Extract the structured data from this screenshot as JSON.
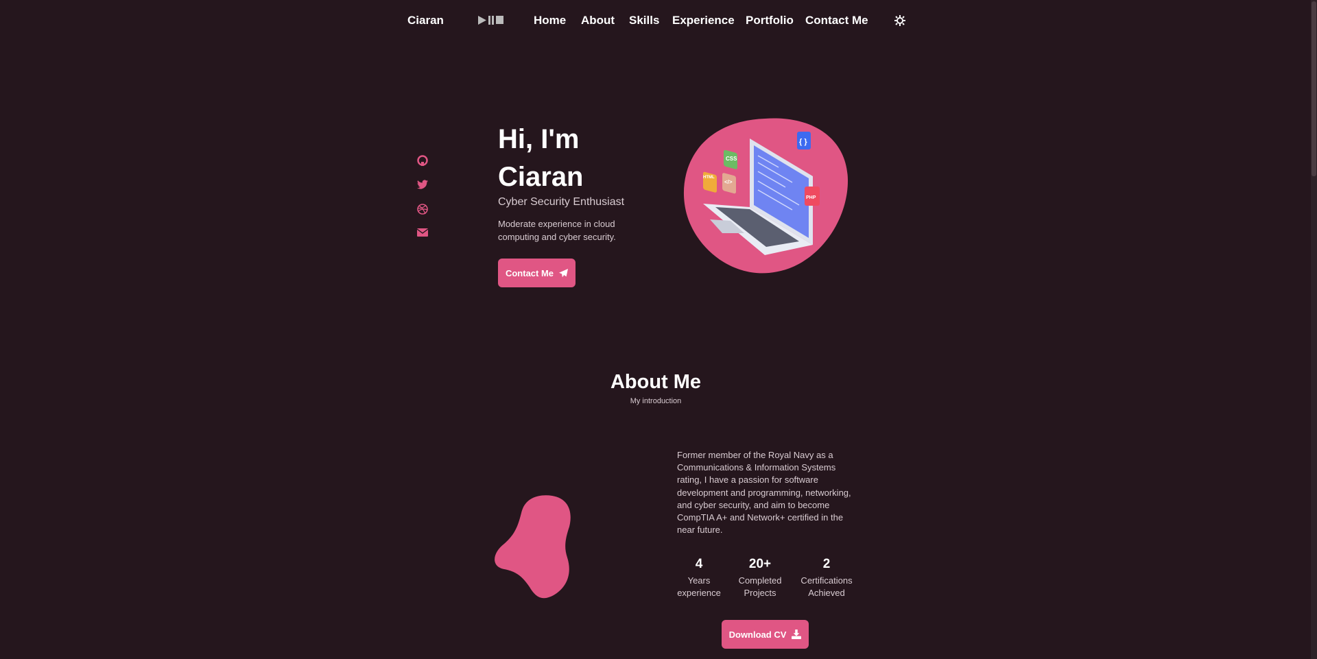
{
  "nav": {
    "logo": "Ciaran",
    "items": [
      "Home",
      "About",
      "Skills",
      "Experience",
      "Portfolio",
      "Contact Me"
    ]
  },
  "hero": {
    "title_line1": "Hi, I'm",
    "title_line2": "Ciaran",
    "subtitle": "Cyber Security Enthusiast",
    "description_line1": "Moderate experience in cloud",
    "description_line2": "computing and cyber security.",
    "button": "Contact Me",
    "badges": [
      "CSS",
      "HTML",
      "</>",
      "{ }",
      "PHP"
    ]
  },
  "about": {
    "title": "About Me",
    "subtitle": "My introduction",
    "text": "Former member of the Royal Navy as a Communications & Information Systems rating, I have a passion for software development and programming, networking, and cyber security, and aim to become CompTIA A+ and Network+ certified in the near future.",
    "stats": [
      {
        "number": "4",
        "line1": "Years",
        "line2": "experience"
      },
      {
        "number": "20+",
        "line1": "Completed",
        "line2": "Projects"
      },
      {
        "number": "2",
        "line1": "Certifications",
        "line2": "Achieved"
      }
    ],
    "button": "Download CV"
  },
  "colors": {
    "background": "#25161d",
    "accent": "#e05684"
  }
}
